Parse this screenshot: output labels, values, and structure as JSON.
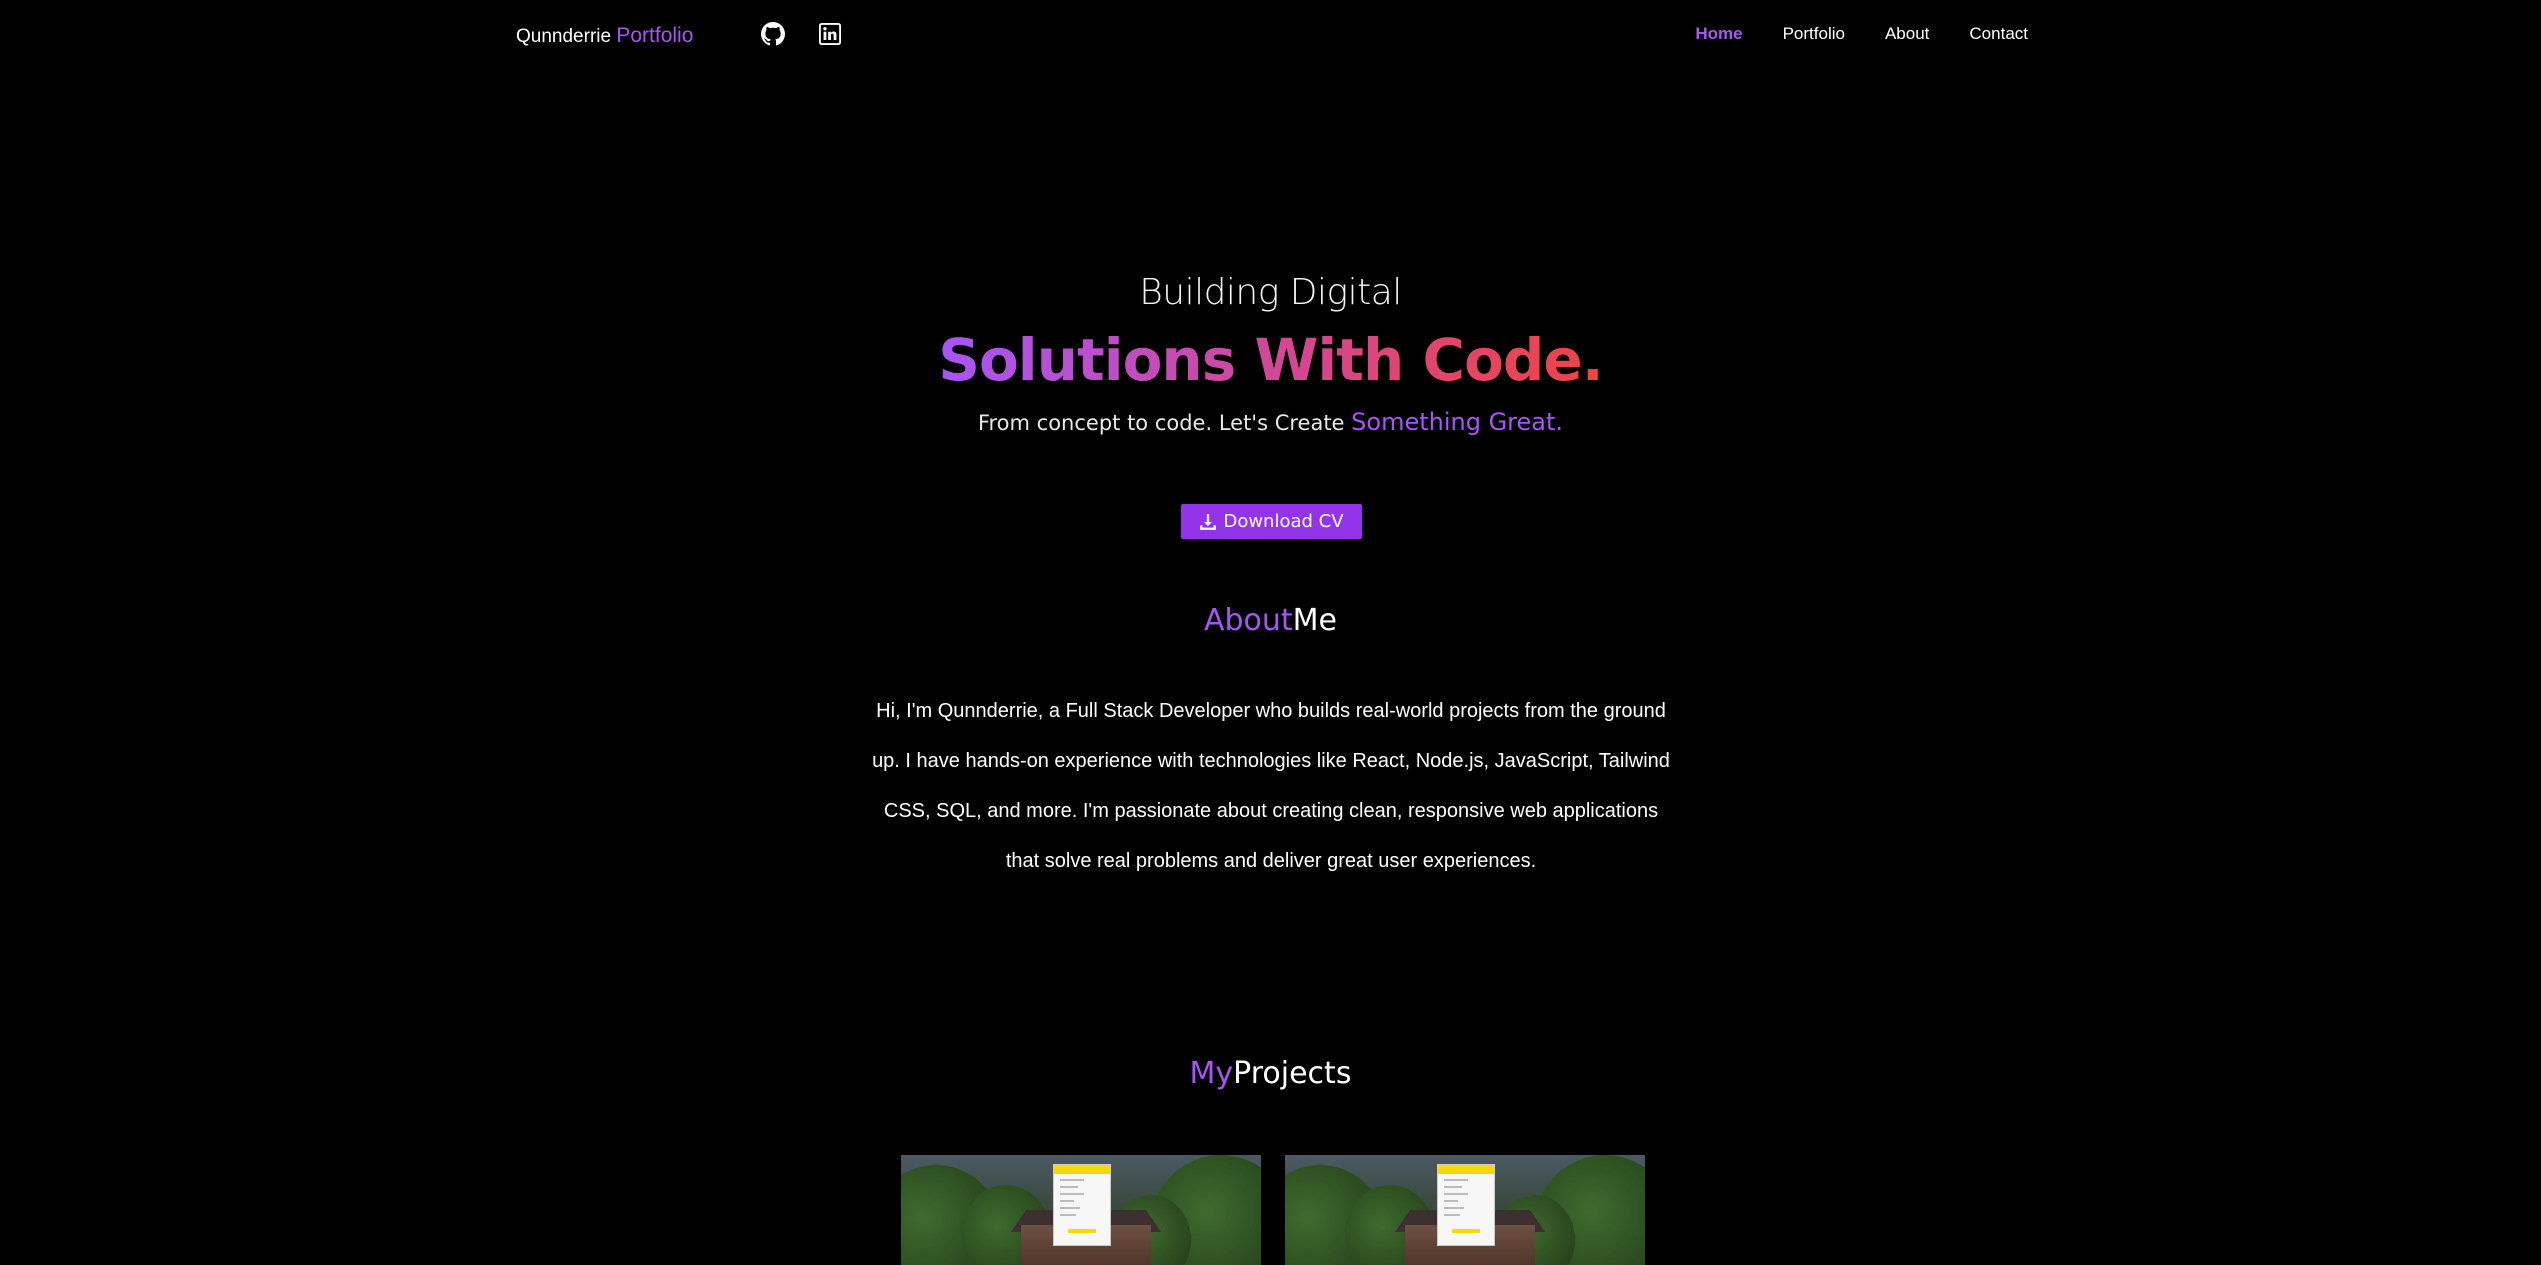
{
  "nav": {
    "brand_name": "Qunnderrie",
    "brand_accent": "Portfolio",
    "social": [
      {
        "icon": "github-icon"
      },
      {
        "icon": "linkedin-icon"
      }
    ],
    "links": [
      "Home",
      "Portfolio",
      "About",
      "Contact"
    ],
    "active_link": "Home"
  },
  "hero": {
    "line1": "Building Digital",
    "title": "Solutions With Code.",
    "subtitle_prefix": "From concept to code. Let's Create ",
    "subtitle_accent": "Something Great.",
    "download_label": "Download CV",
    "download_icon": "download-icon"
  },
  "about": {
    "title_accent": "About",
    "title_rest": "Me",
    "text": "Hi, I'm Qunnderrie, a Full Stack Developer who builds real-world projects from the ground up. I have hands-on experience with technologies like React, Node.js, JavaScript, Tailwind CSS, SQL, and more. I'm passionate about creating clean, responsive web applications that solve real problems and deliver great user experiences."
  },
  "projects": {
    "title_accent": "My",
    "title_rest": "Projects",
    "cards": [
      {
        "thumbnail": "project-screenshot"
      },
      {
        "thumbnail": "project-screenshot"
      }
    ]
  },
  "colors": {
    "background": "#000000",
    "accent": "#a855f7",
    "gradient_start": "#a855f7",
    "gradient_end": "#ef4444",
    "button": "#9333ea"
  }
}
